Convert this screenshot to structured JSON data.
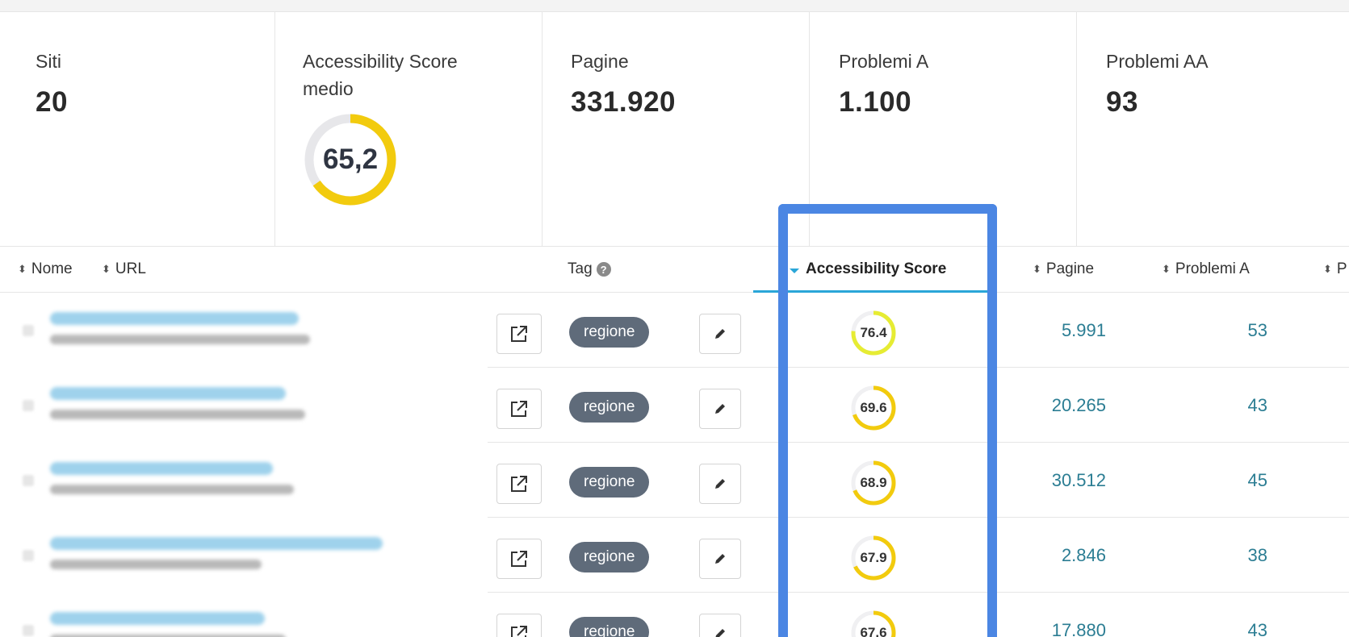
{
  "stats": [
    {
      "label": "Siti",
      "value": "20"
    },
    {
      "label": "Accessibility Score medio",
      "value": "65,2",
      "score_fraction": 0.652
    },
    {
      "label": "Pagine",
      "value": "331.920"
    },
    {
      "label": "Problemi A",
      "value": "1.100"
    },
    {
      "label": "Problemi AA",
      "value": "93"
    }
  ],
  "columns": {
    "nome": "Nome",
    "url": "URL",
    "tag": "Tag",
    "accessibility_score": "Accessibility Score",
    "pagine": "Pagine",
    "problemi_a": "Problemi A",
    "truncated": "P"
  },
  "icons": {
    "sort": "sort-icon",
    "help": "question-circle-icon",
    "external": "external-link-icon",
    "edit": "pencil-icon"
  },
  "colors": {
    "gauge_yellow": "#f2cb0e",
    "gauge_bright_yellow": "#e6ec33",
    "gauge_track": "#e7e7ea",
    "tag_bg": "#5f6b7a",
    "link": "#2b7d93",
    "active_sort": "#2aa6d8",
    "highlight": "#4b86e3"
  },
  "rows": [
    {
      "tag": "regione",
      "score": "76.4",
      "score_fraction": 0.764,
      "pagine": "5.991",
      "problemi_a": "53"
    },
    {
      "tag": "regione",
      "score": "69.6",
      "score_fraction": 0.696,
      "pagine": "20.265",
      "problemi_a": "43"
    },
    {
      "tag": "regione",
      "score": "68.9",
      "score_fraction": 0.689,
      "pagine": "30.512",
      "problemi_a": "45"
    },
    {
      "tag": "regione",
      "score": "67.9",
      "score_fraction": 0.679,
      "pagine": "2.846",
      "problemi_a": "38"
    },
    {
      "tag": "regione",
      "score": "67.6",
      "score_fraction": 0.676,
      "pagine": "17.880",
      "problemi_a": "43"
    }
  ]
}
